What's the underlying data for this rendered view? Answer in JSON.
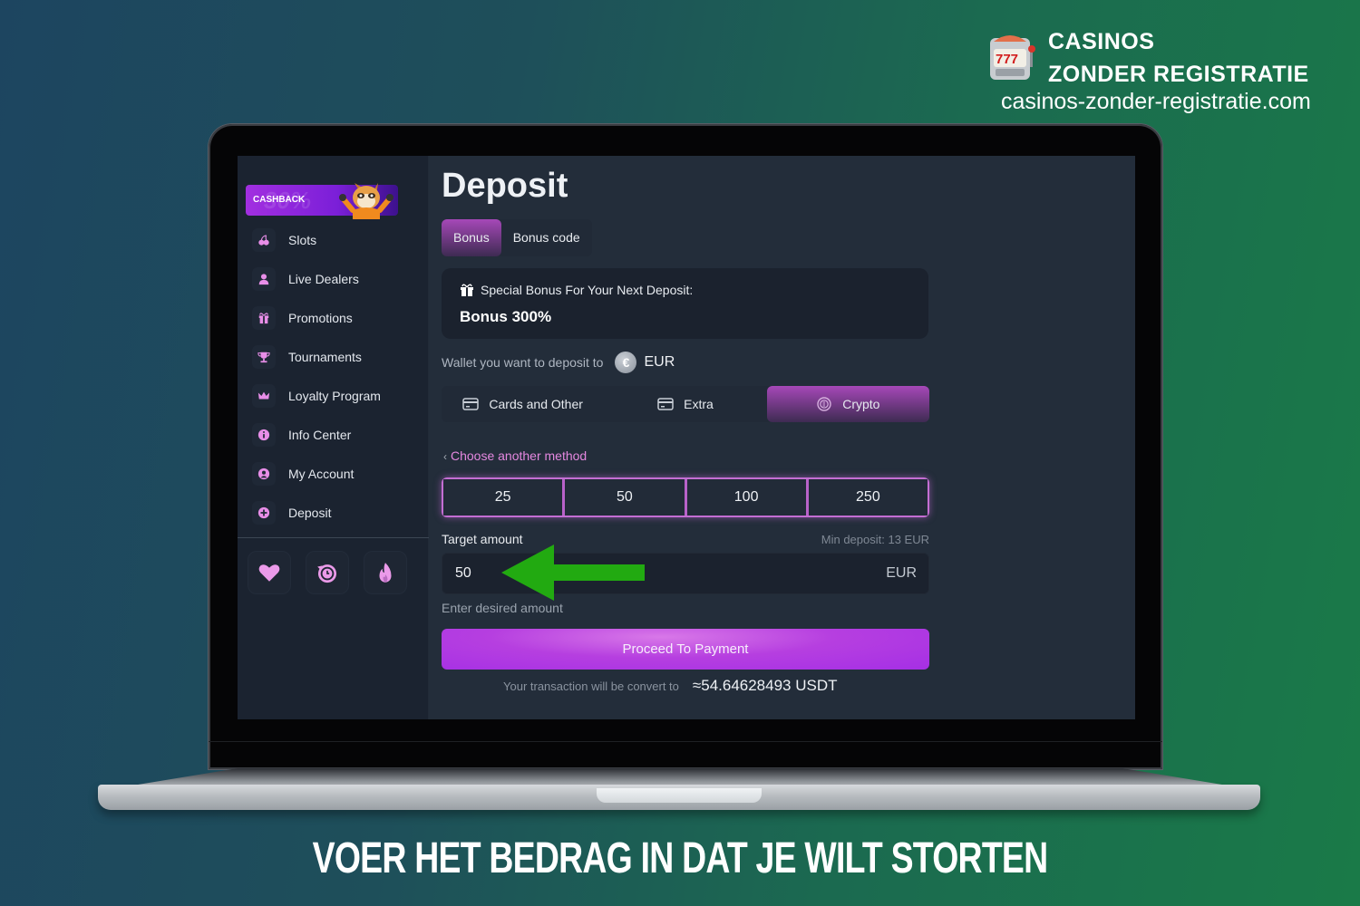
{
  "brand": {
    "title_line1": "CASINOS",
    "title_line2": "ZONDER REGISTRATIE",
    "url": "casinos-zonder-registratie.com",
    "logo_icon": "slot-machine-icon"
  },
  "sidebar": {
    "promo": {
      "label": "CASHBACK",
      "bg_text": "30%",
      "mascot": "raccoon-mascot"
    },
    "items": [
      {
        "label": "Slots",
        "icon": "cherries-icon"
      },
      {
        "label": "Live Dealers",
        "icon": "person-icon"
      },
      {
        "label": "Promotions",
        "icon": "gift-icon"
      },
      {
        "label": "Tournaments",
        "icon": "trophy-icon"
      },
      {
        "label": "Loyalty Program",
        "icon": "crown-icon"
      },
      {
        "label": "Info Center",
        "icon": "info-icon"
      },
      {
        "label": "My Account",
        "icon": "account-icon"
      },
      {
        "label": "Deposit",
        "icon": "plus-circle-icon"
      }
    ],
    "quick_buttons": [
      {
        "icon": "heart-icon"
      },
      {
        "icon": "history-icon"
      },
      {
        "icon": "fire-icon"
      }
    ]
  },
  "main": {
    "title": "Deposit",
    "tabs": [
      {
        "label": "Bonus",
        "active": true
      },
      {
        "label": "Bonus code",
        "active": false
      }
    ],
    "bonus_card": {
      "heading": "Special Bonus For Your Next Deposit:",
      "value": "Bonus 300%"
    },
    "wallet": {
      "label": "Wallet you want to deposit to",
      "currency_symbol": "€",
      "currency": "EUR"
    },
    "methods": [
      {
        "label": "Cards and Other",
        "icon": "card-icon",
        "active": false
      },
      {
        "label": "Extra",
        "icon": "card-icon",
        "active": false
      },
      {
        "label": "Crypto",
        "icon": "crypto-coin-icon",
        "active": true
      }
    ],
    "back_link": "Choose another method",
    "presets": [
      "25",
      "50",
      "100",
      "250"
    ],
    "target_label": "Target amount",
    "min_deposit": "Min deposit: 13 EUR",
    "amount_value": "50",
    "amount_currency": "EUR",
    "hint": "Enter desired amount",
    "proceed_label": "Proceed To Payment",
    "convert_label": "Your transaction will be convert to",
    "convert_value": "≈54.64628493 USDT"
  },
  "caption": "VOER HET BEDRAG IN DAT JE WILT STORTEN",
  "colors": {
    "accent": "#b63fe0",
    "accent_pink": "#e588e0",
    "annotation_arrow": "#22aa11"
  }
}
